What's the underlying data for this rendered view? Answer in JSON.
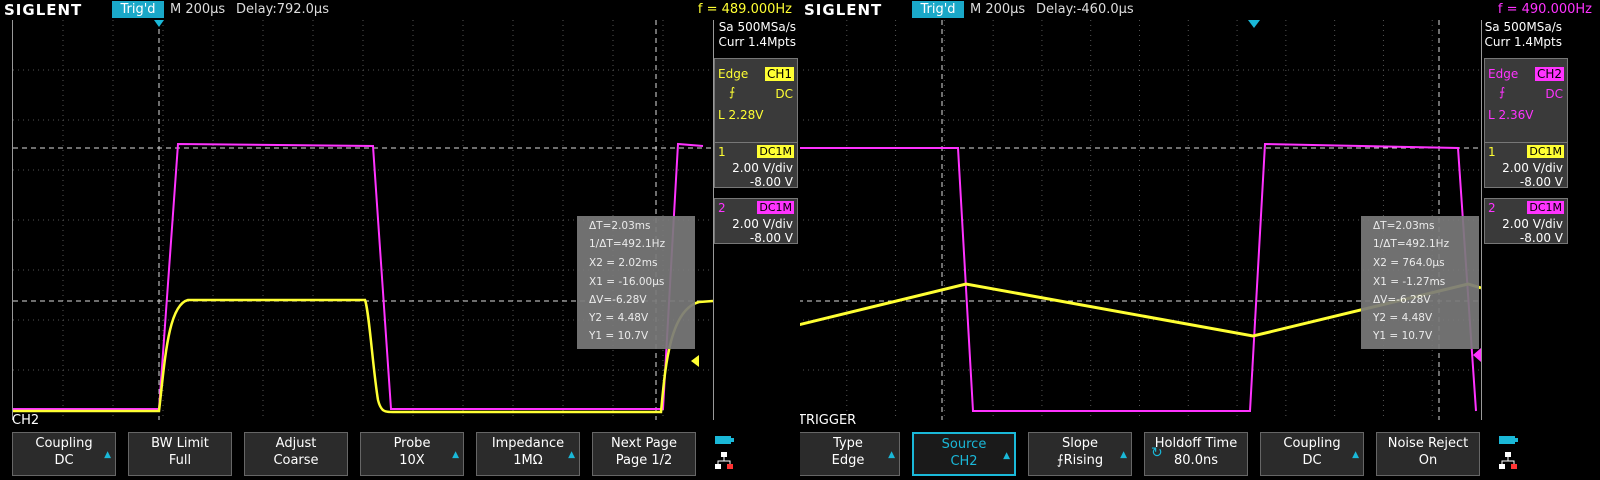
{
  "left": {
    "brand": "SIGLENT",
    "trig_status": "Trig'd",
    "timebase": "M 200μs",
    "delay": "Delay:792.0μs",
    "frequency": "f = 489.000Hz",
    "sample_rate": "Sa 500MSa/s",
    "memory": "Curr 1.4Mpts",
    "trigger": {
      "type": "Edge",
      "source": "CH1",
      "coupling": "DC",
      "level": "L  2.28V"
    },
    "ch1": {
      "num": "1",
      "coupling": "DC1M",
      "scale": "2.00 V/div",
      "offset": "-8.00 V"
    },
    "ch2": {
      "num": "2",
      "coupling": "DC1M",
      "scale": "2.00 V/div",
      "offset": "-8.00 V"
    },
    "measure": [
      "ΔT=2.03ms",
      "1/ΔT=492.1Hz",
      "X2 = 2.02ms",
      "X1 = -16.00μs",
      "ΔV=-6.28V",
      "Y2 = 4.48V",
      "Y1 = 10.7V"
    ],
    "menu_label": "CH2",
    "softkeys": [
      {
        "l1": "Coupling",
        "l2": "DC",
        "arrow": true
      },
      {
        "l1": "BW Limit",
        "l2": "Full",
        "arrow": false
      },
      {
        "l1": "Adjust",
        "l2": "Coarse",
        "arrow": false
      },
      {
        "l1": "Probe",
        "l2": "10X",
        "arrow": true
      },
      {
        "l1": "Impedance",
        "l2": "1MΩ",
        "arrow": true
      },
      {
        "l1": "Next Page",
        "l2": "Page 1/2",
        "arrow": false
      }
    ],
    "colors": {
      "ch1": "#ffff33",
      "ch2": "#ff33ff",
      "accent": "#1ab8d8"
    }
  },
  "right": {
    "brand": "SIGLENT",
    "trig_status": "Trig'd",
    "timebase": "M 200μs",
    "delay": "Delay:-460.0μs",
    "frequency": "f = 490.000Hz",
    "sample_rate": "Sa 500MSa/s",
    "memory": "Curr 1.4Mpts",
    "trigger": {
      "type": "Edge",
      "source": "CH2",
      "coupling": "DC",
      "level": "L  2.36V"
    },
    "ch1": {
      "num": "1",
      "coupling": "DC1M",
      "scale": "2.00 V/div",
      "offset": "-8.00 V"
    },
    "ch2": {
      "num": "2",
      "coupling": "DC1M",
      "scale": "2.00 V/div",
      "offset": "-8.00 V"
    },
    "measure": [
      "ΔT=2.03ms",
      "1/ΔT=492.1Hz",
      "X2 = 764.0μs",
      "X1 = -1.27ms",
      "ΔV=-6.28V",
      "Y2 = 4.48V",
      "Y1 = 10.7V"
    ],
    "menu_label": "TRIGGER",
    "softkeys": [
      {
        "l1": "Type",
        "l2": "Edge",
        "arrow": true
      },
      {
        "l1": "Source",
        "l2": "CH2",
        "arrow": true
      },
      {
        "l1": "Slope",
        "l2": "Rising",
        "arrow": true
      },
      {
        "l1": "Holdoff Time",
        "l2": "80.0ns",
        "arrow": false
      },
      {
        "l1": "Coupling",
        "l2": "DC",
        "arrow": true
      },
      {
        "l1": "Noise Reject",
        "l2": "On",
        "arrow": false
      }
    ]
  }
}
